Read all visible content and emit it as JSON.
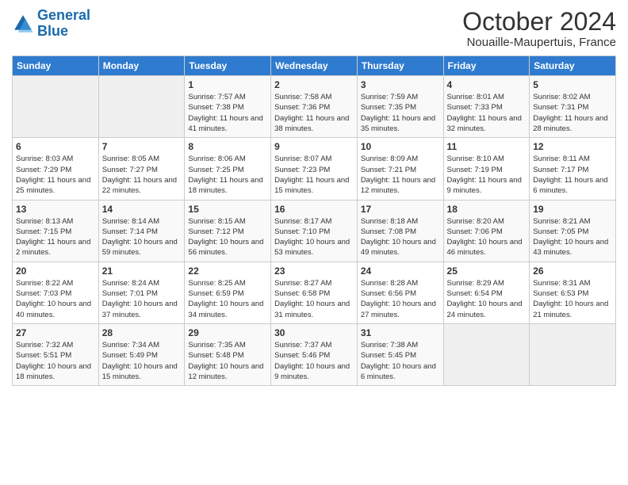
{
  "logo": {
    "line1": "General",
    "line2": "Blue"
  },
  "title": "October 2024",
  "location": "Nouaille-Maupertuis, France",
  "headers": [
    "Sunday",
    "Monday",
    "Tuesday",
    "Wednesday",
    "Thursday",
    "Friday",
    "Saturday"
  ],
  "weeks": [
    [
      {
        "day": "",
        "sunrise": "",
        "sunset": "",
        "daylight": ""
      },
      {
        "day": "",
        "sunrise": "",
        "sunset": "",
        "daylight": ""
      },
      {
        "day": "1",
        "sunrise": "Sunrise: 7:57 AM",
        "sunset": "Sunset: 7:38 PM",
        "daylight": "Daylight: 11 hours and 41 minutes."
      },
      {
        "day": "2",
        "sunrise": "Sunrise: 7:58 AM",
        "sunset": "Sunset: 7:36 PM",
        "daylight": "Daylight: 11 hours and 38 minutes."
      },
      {
        "day": "3",
        "sunrise": "Sunrise: 7:59 AM",
        "sunset": "Sunset: 7:35 PM",
        "daylight": "Daylight: 11 hours and 35 minutes."
      },
      {
        "day": "4",
        "sunrise": "Sunrise: 8:01 AM",
        "sunset": "Sunset: 7:33 PM",
        "daylight": "Daylight: 11 hours and 32 minutes."
      },
      {
        "day": "5",
        "sunrise": "Sunrise: 8:02 AM",
        "sunset": "Sunset: 7:31 PM",
        "daylight": "Daylight: 11 hours and 28 minutes."
      }
    ],
    [
      {
        "day": "6",
        "sunrise": "Sunrise: 8:03 AM",
        "sunset": "Sunset: 7:29 PM",
        "daylight": "Daylight: 11 hours and 25 minutes."
      },
      {
        "day": "7",
        "sunrise": "Sunrise: 8:05 AM",
        "sunset": "Sunset: 7:27 PM",
        "daylight": "Daylight: 11 hours and 22 minutes."
      },
      {
        "day": "8",
        "sunrise": "Sunrise: 8:06 AM",
        "sunset": "Sunset: 7:25 PM",
        "daylight": "Daylight: 11 hours and 18 minutes."
      },
      {
        "day": "9",
        "sunrise": "Sunrise: 8:07 AM",
        "sunset": "Sunset: 7:23 PM",
        "daylight": "Daylight: 11 hours and 15 minutes."
      },
      {
        "day": "10",
        "sunrise": "Sunrise: 8:09 AM",
        "sunset": "Sunset: 7:21 PM",
        "daylight": "Daylight: 11 hours and 12 minutes."
      },
      {
        "day": "11",
        "sunrise": "Sunrise: 8:10 AM",
        "sunset": "Sunset: 7:19 PM",
        "daylight": "Daylight: 11 hours and 9 minutes."
      },
      {
        "day": "12",
        "sunrise": "Sunrise: 8:11 AM",
        "sunset": "Sunset: 7:17 PM",
        "daylight": "Daylight: 11 hours and 6 minutes."
      }
    ],
    [
      {
        "day": "13",
        "sunrise": "Sunrise: 8:13 AM",
        "sunset": "Sunset: 7:15 PM",
        "daylight": "Daylight: 11 hours and 2 minutes."
      },
      {
        "day": "14",
        "sunrise": "Sunrise: 8:14 AM",
        "sunset": "Sunset: 7:14 PM",
        "daylight": "Daylight: 10 hours and 59 minutes."
      },
      {
        "day": "15",
        "sunrise": "Sunrise: 8:15 AM",
        "sunset": "Sunset: 7:12 PM",
        "daylight": "Daylight: 10 hours and 56 minutes."
      },
      {
        "day": "16",
        "sunrise": "Sunrise: 8:17 AM",
        "sunset": "Sunset: 7:10 PM",
        "daylight": "Daylight: 10 hours and 53 minutes."
      },
      {
        "day": "17",
        "sunrise": "Sunrise: 8:18 AM",
        "sunset": "Sunset: 7:08 PM",
        "daylight": "Daylight: 10 hours and 49 minutes."
      },
      {
        "day": "18",
        "sunrise": "Sunrise: 8:20 AM",
        "sunset": "Sunset: 7:06 PM",
        "daylight": "Daylight: 10 hours and 46 minutes."
      },
      {
        "day": "19",
        "sunrise": "Sunrise: 8:21 AM",
        "sunset": "Sunset: 7:05 PM",
        "daylight": "Daylight: 10 hours and 43 minutes."
      }
    ],
    [
      {
        "day": "20",
        "sunrise": "Sunrise: 8:22 AM",
        "sunset": "Sunset: 7:03 PM",
        "daylight": "Daylight: 10 hours and 40 minutes."
      },
      {
        "day": "21",
        "sunrise": "Sunrise: 8:24 AM",
        "sunset": "Sunset: 7:01 PM",
        "daylight": "Daylight: 10 hours and 37 minutes."
      },
      {
        "day": "22",
        "sunrise": "Sunrise: 8:25 AM",
        "sunset": "Sunset: 6:59 PM",
        "daylight": "Daylight: 10 hours and 34 minutes."
      },
      {
        "day": "23",
        "sunrise": "Sunrise: 8:27 AM",
        "sunset": "Sunset: 6:58 PM",
        "daylight": "Daylight: 10 hours and 31 minutes."
      },
      {
        "day": "24",
        "sunrise": "Sunrise: 8:28 AM",
        "sunset": "Sunset: 6:56 PM",
        "daylight": "Daylight: 10 hours and 27 minutes."
      },
      {
        "day": "25",
        "sunrise": "Sunrise: 8:29 AM",
        "sunset": "Sunset: 6:54 PM",
        "daylight": "Daylight: 10 hours and 24 minutes."
      },
      {
        "day": "26",
        "sunrise": "Sunrise: 8:31 AM",
        "sunset": "Sunset: 6:53 PM",
        "daylight": "Daylight: 10 hours and 21 minutes."
      }
    ],
    [
      {
        "day": "27",
        "sunrise": "Sunrise: 7:32 AM",
        "sunset": "Sunset: 5:51 PM",
        "daylight": "Daylight: 10 hours and 18 minutes."
      },
      {
        "day": "28",
        "sunrise": "Sunrise: 7:34 AM",
        "sunset": "Sunset: 5:49 PM",
        "daylight": "Daylight: 10 hours and 15 minutes."
      },
      {
        "day": "29",
        "sunrise": "Sunrise: 7:35 AM",
        "sunset": "Sunset: 5:48 PM",
        "daylight": "Daylight: 10 hours and 12 minutes."
      },
      {
        "day": "30",
        "sunrise": "Sunrise: 7:37 AM",
        "sunset": "Sunset: 5:46 PM",
        "daylight": "Daylight: 10 hours and 9 minutes."
      },
      {
        "day": "31",
        "sunrise": "Sunrise: 7:38 AM",
        "sunset": "Sunset: 5:45 PM",
        "daylight": "Daylight: 10 hours and 6 minutes."
      },
      {
        "day": "",
        "sunrise": "",
        "sunset": "",
        "daylight": ""
      },
      {
        "day": "",
        "sunrise": "",
        "sunset": "",
        "daylight": ""
      }
    ]
  ]
}
